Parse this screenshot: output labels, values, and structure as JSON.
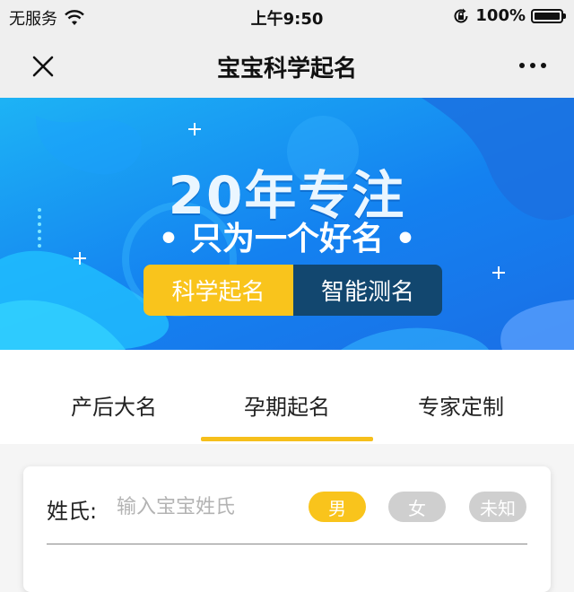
{
  "status_bar": {
    "carrier": "无服务",
    "time": "上午9:50",
    "battery_percent": "100%",
    "battery_level": 1.0,
    "icons": [
      "wifi-icon",
      "rotation-lock-icon",
      "battery-icon"
    ]
  },
  "nav_bar": {
    "title": "宝宝科学起名",
    "close_icon": "close-icon",
    "more_icon": "more-icon"
  },
  "banner": {
    "headline": "20年专注",
    "subline": "• 只为一个好名 •",
    "buttons": [
      {
        "label": "科学起名",
        "color": "#f9c41c"
      },
      {
        "label": "智能测名",
        "color": "#12476f"
      }
    ]
  },
  "tabs": {
    "items": [
      {
        "label": "产后大名",
        "active": false
      },
      {
        "label": "孕期起名",
        "active": true
      },
      {
        "label": "专家定制",
        "active": false
      }
    ],
    "indicator_color": "#f6bf1b"
  },
  "form": {
    "surname_label": "姓氏:",
    "surname_value": "",
    "surname_placeholder": "输入宝宝姓氏",
    "genders": [
      {
        "label": "男",
        "selected": true,
        "color": "#f9c41c"
      },
      {
        "label": "女",
        "selected": false,
        "color": "#cfcfcf"
      },
      {
        "label": "未知",
        "selected": false,
        "color": "#cfcfcf"
      }
    ]
  }
}
